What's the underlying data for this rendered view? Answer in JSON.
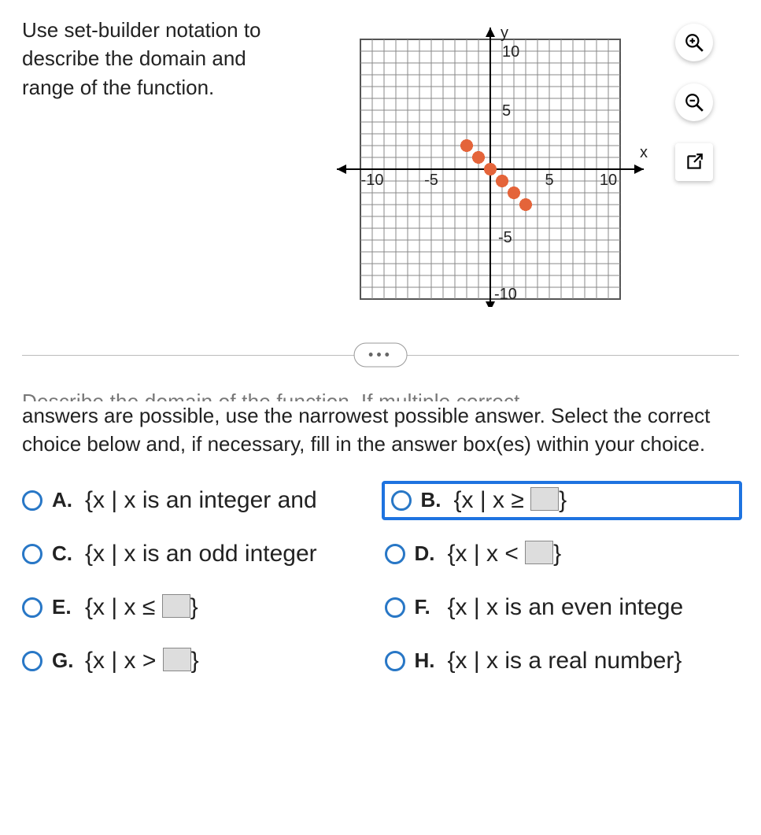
{
  "prompt": "Use set-builder notation to describe the domain and range of the function.",
  "graph": {
    "xlabel": "x",
    "ylabel": "y",
    "ticks": {
      "neg10": "-10",
      "neg5": "-5",
      "pos5": "5",
      "pos10": "10"
    },
    "chart_data": {
      "type": "scatter",
      "points": [
        {
          "x": -2,
          "y": 2
        },
        {
          "x": -1,
          "y": 1
        },
        {
          "x": 0,
          "y": 0
        },
        {
          "x": 1,
          "y": -1
        },
        {
          "x": 2,
          "y": -2
        },
        {
          "x": 3,
          "y": -3
        }
      ],
      "xlim": [
        -11,
        11
      ],
      "ylim": [
        -11,
        11
      ]
    }
  },
  "divider_label": "•••",
  "cutoff_text": "Describe the domain of the function. If multiple correct",
  "instruction": "answers are possible, use the narrowest possible answer. Select the correct choice below and, if necessary, fill in the answer box(es) within your choice.",
  "choices": {
    "A": {
      "label": "A.",
      "text": "{x | x is an integer and"
    },
    "B": {
      "label": "B.",
      "prefix": "{x | x ≥ ",
      "suffix": "}"
    },
    "C": {
      "label": "C.",
      "text": "{x | x is an odd integer"
    },
    "D": {
      "label": "D.",
      "prefix": "{x | x < ",
      "suffix": "}"
    },
    "E": {
      "label": "E.",
      "prefix": "{x | x ≤ ",
      "suffix": "}"
    },
    "F": {
      "label": "F.",
      "text": "{x | x is an even intege"
    },
    "G": {
      "label": "G.",
      "prefix": "{x | x > ",
      "suffix": "}"
    },
    "H": {
      "label": "H.",
      "text": "{x | x is a real number}"
    }
  },
  "tools": {
    "zoom_in": "zoom-in",
    "zoom_out": "zoom-out",
    "open": "open-new"
  }
}
